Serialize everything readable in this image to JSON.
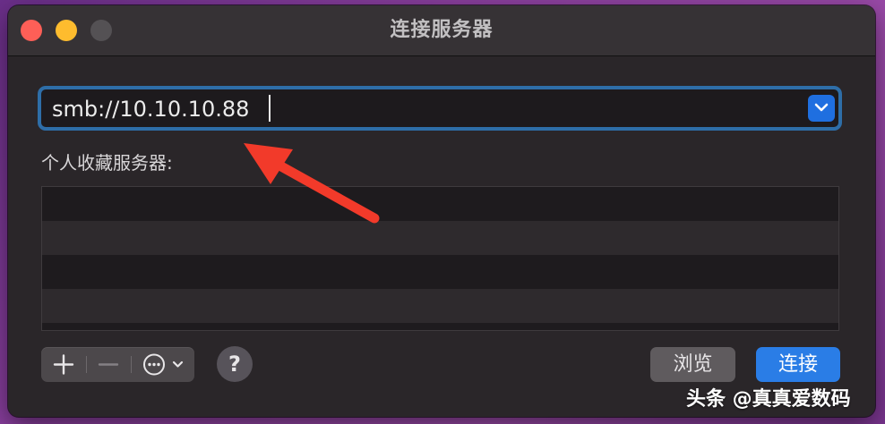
{
  "window": {
    "title": "连接服务器"
  },
  "address": {
    "value": "smb://10.10.10.88",
    "dropdown_icon": "chevron-down-icon"
  },
  "favorites": {
    "label": "个人收藏服务器:",
    "rows": [
      "",
      "",
      "",
      ""
    ]
  },
  "toolbar": {
    "add_icon": "plus-icon",
    "remove_icon": "minus-icon",
    "more_icon": "ellipsis-circle-icon",
    "help_label": "?",
    "browse_label": "浏览",
    "connect_label": "连接"
  },
  "watermark": {
    "text": "头条 @真真爱数码"
  },
  "colors": {
    "accent": "#2a7de6",
    "focus_ring": "#2e6ea8",
    "annotation_arrow": "#f23a2a",
    "close": "#fe5f57",
    "minimize": "#febc2e"
  }
}
